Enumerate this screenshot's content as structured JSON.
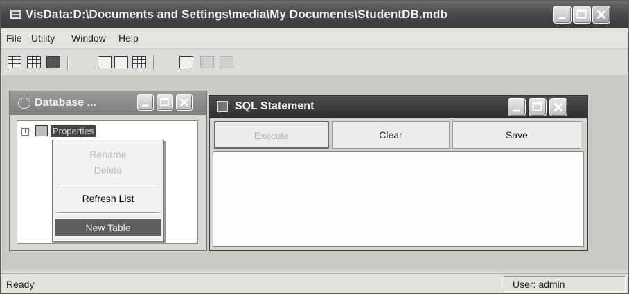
{
  "window": {
    "title": "VisData:D:\\Documents and Settings\\media\\My Documents\\StudentDB.mdb"
  },
  "menu": [
    {
      "label": "File"
    },
    {
      "label": "Utility"
    },
    {
      "label": "Window"
    },
    {
      "label": "Help"
    }
  ],
  "toolbar": {
    "icons": [
      "table-type-icon",
      "dynaset-type-icon",
      "snapshot-type-icon",
      "data-control-form-icon",
      "no-data-control-form-icon",
      "dbgrid-form-icon",
      "begin-transaction-icon",
      "commit-icon",
      "rollback-icon"
    ]
  },
  "database_window": {
    "title": "Database ...",
    "tree_node": "Properties"
  },
  "context_menu": {
    "items": [
      {
        "label": "Rename",
        "enabled": false
      },
      {
        "label": "Delete",
        "enabled": false
      },
      {
        "label": "Refresh List",
        "enabled": true
      },
      {
        "label": "New Table",
        "enabled": true,
        "selected": true
      }
    ]
  },
  "sql_window": {
    "title": "SQL Statement",
    "buttons": {
      "execute": "Execute",
      "clear": "Clear",
      "save": "Save"
    }
  },
  "statusbar": {
    "status": "Ready",
    "user": "User: admin"
  }
}
